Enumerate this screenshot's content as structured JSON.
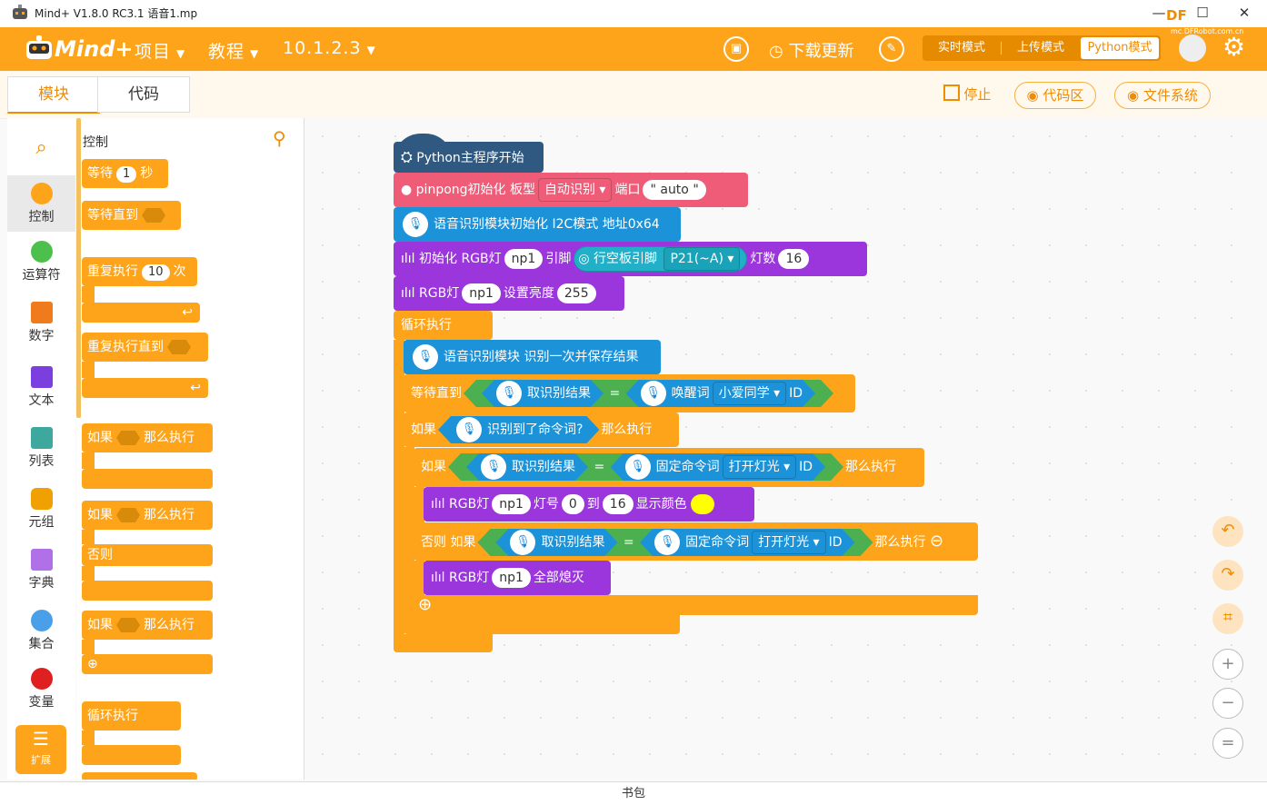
{
  "window": {
    "title": "Mind+ V1.8.0 RC3.1    语音1.mp",
    "minimize": "—",
    "maximize": "☐",
    "close": "✕",
    "brand_badge": "DF",
    "brand_url": "mc.DFRobot.com.cn"
  },
  "menu": {
    "logo": "Mind+",
    "project": "项目",
    "tutorial": "教程",
    "version": "10.1.2.3",
    "download_update": "下载更新"
  },
  "modes": {
    "realtime": "实时模式",
    "upload": "上传模式",
    "python": "Python模式"
  },
  "toolbar": {
    "tab_blocks": "模块",
    "tab_code": "代码",
    "stop": "停止",
    "code_area": "代码区",
    "file_system": "文件系统"
  },
  "categories": [
    {
      "label": "控制",
      "color": "#fea41a"
    },
    {
      "label": "运算符",
      "color": "#4cbf4c"
    },
    {
      "label": "数字",
      "color": "#f07b1d"
    },
    {
      "label": "文本",
      "color": "#7b3fe0"
    },
    {
      "label": "列表",
      "color": "#3fa89e"
    },
    {
      "label": "元组",
      "color": "#f0a000"
    },
    {
      "label": "字典",
      "color": "#b070e8"
    },
    {
      "label": "集合",
      "color": "#4aa0e8"
    },
    {
      "label": "变量",
      "color": "#e02020"
    }
  ],
  "extension": {
    "label": "扩展"
  },
  "palette": {
    "title": "控制",
    "wait": "等待",
    "wait_value": "1",
    "wait_unit": "秒",
    "wait_until": "等待直到",
    "repeat": "重复执行",
    "repeat_value": "10",
    "repeat_unit": "次",
    "repeat_until": "重复执行直到",
    "if": "如果",
    "then": "那么执行",
    "else": "否则",
    "forever": "循环执行"
  },
  "script": {
    "hat": "Python主程序开始",
    "pinpong_init": "pinpong初始化 板型",
    "board": "自动识别",
    "port_label": "端口",
    "port_value": "\" auto \"",
    "voice_init": "语音识别模块初始化 I2C模式 地址0x64",
    "rgb_init": "初始化 RGB灯",
    "np1": "np1",
    "pin_label": "引脚",
    "board_pin": "行空板引脚",
    "pin_value": "P21(~A)",
    "count_label": "灯数",
    "count_value": "16",
    "rgb_bright": "RGB灯",
    "bright_label": "设置亮度",
    "bright_value": "255",
    "forever": "循环执行",
    "recognize_once": "语音识别模块 识别一次并保存结果",
    "wait_until": "等待直到",
    "result": "取识别结果",
    "eq": "=",
    "wake_word": "唤醒词",
    "wake_value": "小爱同学",
    "id": "ID",
    "if": "如果",
    "got_command": "识别到了命令词?",
    "then": "那么执行",
    "fixed_cmd": "固定命令词",
    "cmd_value": "打开灯光",
    "rgb_led": "RGB灯",
    "led_no": "灯号",
    "from": "0",
    "to_label": "到",
    "to": "16",
    "show_color": "显示颜色",
    "else_if": "否则 如果",
    "all_off": "全部熄灭"
  },
  "backpack": "书包"
}
